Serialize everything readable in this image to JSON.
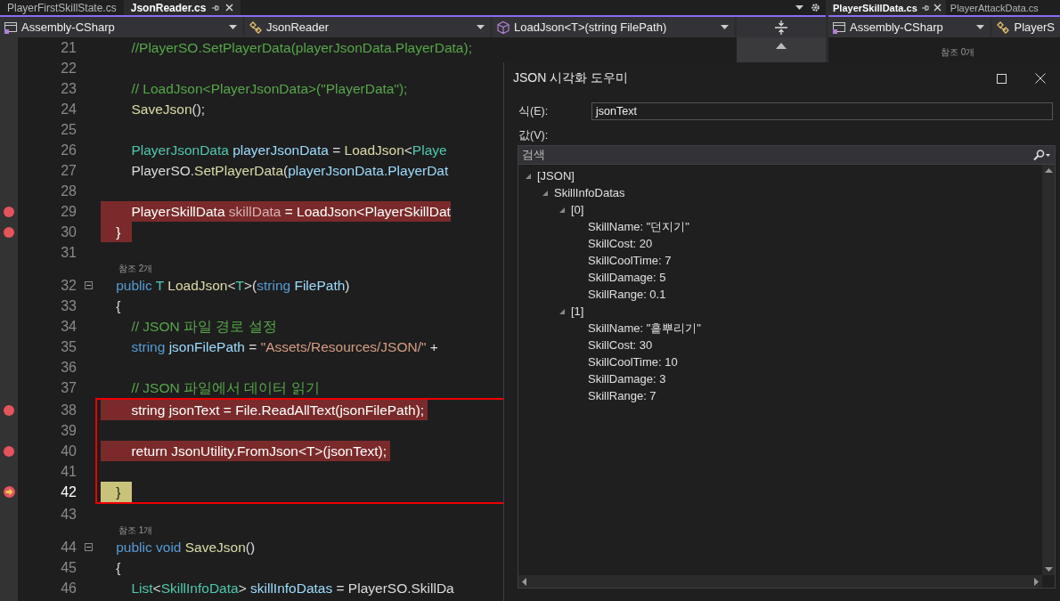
{
  "left_pane": {
    "tabs": [
      {
        "label": "PlayerFirstSkillState.cs",
        "selected": false
      },
      {
        "label": "JsonReader.cs",
        "selected": true
      }
    ],
    "nav": {
      "project": "Assembly-CSharp",
      "type": "JsonReader",
      "member": "LoadJson<T>(string FilePath)"
    },
    "lines": [
      {
        "number": "21",
        "tokens": [
          {
            "kind": "comment",
            "text": "        //PlayerSO.SetPlayerData(playerJsonData.PlayerData);"
          }
        ]
      },
      {
        "number": "22"
      },
      {
        "number": "23",
        "tokens": [
          {
            "kind": "comment",
            "text": "        // LoadJson<PlayerJsonData>(\"PlayerData\");"
          }
        ]
      },
      {
        "number": "24",
        "tokens": [
          {
            "kind": "method",
            "text": "        SaveJson"
          },
          {
            "kind": "plain",
            "text": "();"
          }
        ]
      },
      {
        "number": "25"
      },
      {
        "number": "26",
        "tokens": [
          {
            "kind": "type",
            "text": "        PlayerJsonData"
          },
          {
            "kind": "var",
            "text": " playerJsonData"
          },
          {
            "kind": "plain",
            "text": " = "
          },
          {
            "kind": "method",
            "text": "LoadJson"
          },
          {
            "kind": "plain",
            "text": "<"
          },
          {
            "kind": "type",
            "text": "Playe"
          }
        ]
      },
      {
        "number": "27",
        "tokens": [
          {
            "kind": "plain",
            "text": "        PlayerSO."
          },
          {
            "kind": "method",
            "text": "SetPlayerData"
          },
          {
            "kind": "plain",
            "text": "("
          },
          {
            "kind": "var",
            "text": "playerJsonData.PlayerDat"
          }
        ]
      },
      {
        "number": "28"
      },
      {
        "number": "29",
        "breakpoint": true,
        "tokens": [
          {
            "kind": "type",
            "text": "        PlayerSkillData"
          },
          {
            "kind": "unused",
            "text": " skillData"
          },
          {
            "kind": "plain",
            "text": " = "
          },
          {
            "kind": "method",
            "text": "LoadJson"
          },
          {
            "kind": "plain",
            "text": "<"
          },
          {
            "kind": "type",
            "text": "PlayerSkillDat"
          }
        ]
      },
      {
        "number": "30",
        "breakpoint": true,
        "tokens": [
          {
            "kind": "plain",
            "text": "    }   "
          }
        ]
      },
      {
        "number": "31"
      },
      {
        "number": "32",
        "codelens": "참조 2개",
        "tokens": [
          {
            "kind": "keyword",
            "text": "    public"
          },
          {
            "kind": "type",
            "text": " T "
          },
          {
            "kind": "method",
            "text": "LoadJson"
          },
          {
            "kind": "plain",
            "text": "<"
          },
          {
            "kind": "type",
            "text": "T"
          },
          {
            "kind": "plain",
            "text": ">("
          },
          {
            "kind": "keyword",
            "text": "string"
          },
          {
            "kind": "var",
            "text": " FilePath"
          },
          {
            "kind": "plain",
            "text": ")"
          }
        ]
      },
      {
        "number": "33",
        "tokens": [
          {
            "kind": "plain",
            "text": "    {"
          }
        ]
      },
      {
        "number": "34",
        "tokens": [
          {
            "kind": "comment",
            "text": "        // JSON 파일 경로 설정"
          }
        ]
      },
      {
        "number": "35",
        "tokens": [
          {
            "kind": "keyword",
            "text": "        string"
          },
          {
            "kind": "var",
            "text": " jsonFilePath"
          },
          {
            "kind": "plain",
            "text": " = "
          },
          {
            "kind": "string",
            "text": "\"Assets/Resources/JSON/\""
          },
          {
            "kind": "plain",
            "text": " +"
          }
        ]
      },
      {
        "number": "36"
      },
      {
        "number": "37",
        "tokens": [
          {
            "kind": "comment",
            "text": "        // JSON 파일에서 데이터 읽기"
          }
        ]
      },
      {
        "number": "38",
        "breakpoint": true,
        "boxed": true,
        "tokens": [
          {
            "kind": "keyword",
            "text": "        string"
          },
          {
            "kind": "var",
            "text": " jsonText"
          },
          {
            "kind": "plain",
            "text": " = File."
          },
          {
            "kind": "method",
            "text": "ReadAllText"
          },
          {
            "kind": "plain",
            "text": "("
          },
          {
            "kind": "var",
            "text": "jsonFilePath"
          },
          {
            "kind": "plain",
            "text": "); "
          }
        ]
      },
      {
        "number": "39",
        "boxed": true
      },
      {
        "number": "40",
        "breakpoint": true,
        "boxed": true,
        "tokens": [
          {
            "kind": "keyword",
            "text": "        return"
          },
          {
            "kind": "type",
            "text": " JsonUtility"
          },
          {
            "kind": "plain",
            "text": "."
          },
          {
            "kind": "method",
            "text": "FromJson"
          },
          {
            "kind": "plain",
            "text": "<T>("
          },
          {
            "kind": "var",
            "text": "jsonText"
          },
          {
            "kind": "plain",
            "text": "); "
          }
        ]
      },
      {
        "number": "41",
        "boxed": true
      },
      {
        "number": "42",
        "current": true,
        "boxed": true,
        "tokens": [
          {
            "kind": "plain",
            "text": "    }   "
          }
        ]
      },
      {
        "number": "43"
      },
      {
        "number": "44",
        "codelens": "참조 1개",
        "tokens": [
          {
            "kind": "keyword",
            "text": "    public void "
          },
          {
            "kind": "method",
            "text": "SaveJson"
          },
          {
            "kind": "plain",
            "text": "()"
          }
        ]
      },
      {
        "number": "45",
        "tokens": [
          {
            "kind": "plain",
            "text": "    {"
          }
        ]
      },
      {
        "number": "46",
        "tokens": [
          {
            "kind": "type",
            "text": "        List"
          },
          {
            "kind": "plain",
            "text": "<"
          },
          {
            "kind": "type",
            "text": "SkillInfoData"
          },
          {
            "kind": "plain",
            "text": "> "
          },
          {
            "kind": "var",
            "text": "skillInfoDatas"
          },
          {
            "kind": "plain",
            "text": " = PlayerSO.SkillDa"
          }
        ]
      }
    ]
  },
  "right_pane": {
    "tabs": [
      {
        "label": "PlayerSkillData.cs",
        "selected": true
      },
      {
        "label": "PlayerAttackData.cs",
        "selected": false
      }
    ],
    "nav": {
      "project": "Assembly-CSharp",
      "type": "PlayerS"
    },
    "codelens": "참조 0개"
  },
  "visualizer": {
    "title": "JSON 시각화 도우미",
    "expression_label": "식(E):",
    "expression": "jsonText",
    "value_label": "값(V):",
    "search": {
      "placeholder": "검색"
    },
    "tree": [
      {
        "label": "[JSON]",
        "expanded": true,
        "children": [
          {
            "label": "SkillInfoDatas",
            "expanded": true,
            "children": [
              {
                "label": "[0]",
                "expanded": true,
                "children": [
                  {
                    "label": "SkillName: \"던지기\""
                  },
                  {
                    "label": "SkillCost: 20"
                  },
                  {
                    "label": "SkillCoolTime: 7"
                  },
                  {
                    "label": "SkillDamage: 5"
                  },
                  {
                    "label": "SkillRange: 0.1"
                  }
                ]
              },
              {
                "label": "[1]",
                "expanded": true,
                "children": [
                  {
                    "label": "SkillName: \"흩뿌리기\""
                  },
                  {
                    "label": "SkillCost: 30"
                  },
                  {
                    "label": "SkillCoolTime: 10"
                  },
                  {
                    "label": "SkillDamage: 3"
                  },
                  {
                    "label": "SkillRange: 7"
                  }
                ]
              }
            ]
          }
        ]
      }
    ]
  }
}
